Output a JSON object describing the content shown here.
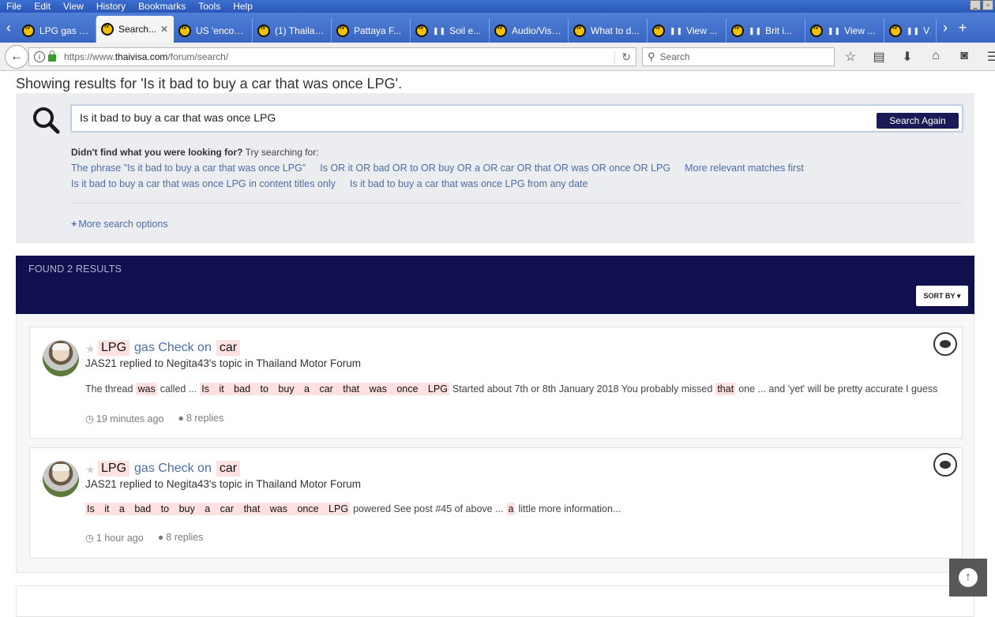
{
  "menubar": {
    "items": [
      "File",
      "Edit",
      "View",
      "History",
      "Bookmarks",
      "Tools",
      "Help"
    ]
  },
  "tabs": [
    {
      "label": "LPG gas C...",
      "active": false,
      "paused": false
    },
    {
      "label": "Search...",
      "active": true,
      "paused": false
    },
    {
      "label": "US 'encour...",
      "active": false,
      "paused": false
    },
    {
      "label": "(1) Thailan...",
      "active": false,
      "paused": false
    },
    {
      "label": "Pattaya F...",
      "active": false,
      "paused": false
    },
    {
      "label": "Soil e...",
      "active": false,
      "paused": true
    },
    {
      "label": "Audio/Visu...",
      "active": false,
      "paused": false
    },
    {
      "label": "What to d...",
      "active": false,
      "paused": false
    },
    {
      "label": "View ...",
      "active": false,
      "paused": true
    },
    {
      "label": "Brit i...",
      "active": false,
      "paused": true
    },
    {
      "label": "View ...",
      "active": false,
      "paused": true
    },
    {
      "label": "View ...",
      "active": false,
      "paused": true
    }
  ],
  "nav": {
    "url_prefix": "https://www.",
    "url_domain": "thaivisa.com",
    "url_suffix": "/forum/search/",
    "search_placeholder": "Search"
  },
  "page": {
    "showing_text": "Showing results for 'Is it bad to buy a car that was once LPG'.",
    "search_query": "Is it bad to buy a car that was once LPG",
    "search_again_label": "Search Again",
    "didnt_find_bold": "Didn't find what you were looking for?",
    "didnt_find_rest": " Try searching for:",
    "suggestions_row1": [
      "The phrase \"Is it bad to buy a car that was once LPG\"",
      "Is OR it OR bad OR to OR buy OR a OR car OR that OR was OR once OR LPG",
      "More relevant matches first"
    ],
    "suggestions_row2": [
      "Is it bad to buy a car that was once LPG in content titles only",
      "Is it bad to buy a car that was once LPG from any date"
    ],
    "more_search_options": "More search options",
    "found_results": "FOUND 2 RESULTS",
    "sort_by": "SORT BY"
  },
  "results": [
    {
      "title_hl1": "LPG",
      "title_mid": "gas Check on",
      "title_hl2": "car",
      "meta": "JAS21 replied to Negita43's topic in Thailand Motor Forum",
      "snippet_pre": "The thread",
      "snippet_hl_was": "was",
      "snippet_mid1": "called ...",
      "snippet_hl_phrase": "Is it bad to buy a car that was once LPG",
      "snippet_mid2": "Started about 7th or 8th January 2018 You probably missed",
      "snippet_hl_that": "that",
      "snippet_post": "one ... and 'yet' will be pretty accurate I guess",
      "time": "19 minutes ago",
      "replies": "8 replies"
    },
    {
      "title_hl1": "LPG",
      "title_mid": "gas Check on",
      "title_hl2": "car",
      "meta": "JAS21 replied to Negita43's topic in Thailand Motor Forum",
      "snippet_hl_phrase": "Is it a bad to buy a car that was once LPG",
      "snippet_mid1": "powered See post #45 of above ...",
      "snippet_hl_a": "a",
      "snippet_post": "little more information...",
      "time": "1 hour ago",
      "replies": "8 replies"
    }
  ],
  "colors": {
    "header_navy": "#10104e",
    "link_blue": "#4b6ea6",
    "highlight_pink": "#ffe1e1",
    "panel_gray": "#ebedf0"
  }
}
